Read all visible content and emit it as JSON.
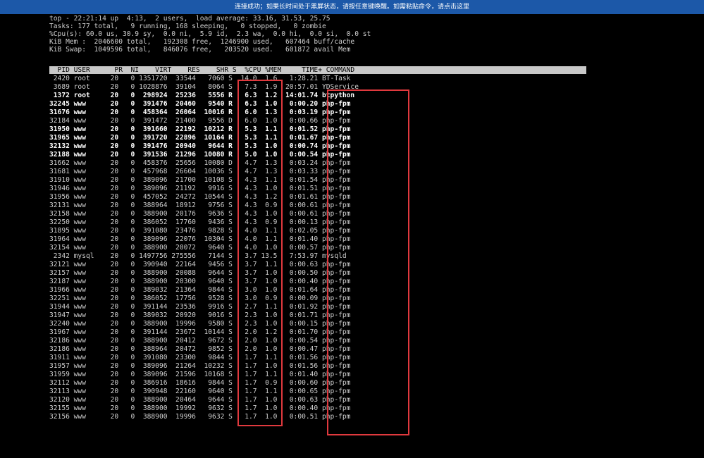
{
  "banner": {
    "text": "连接成功；如果长时间处于黑屏状态，请按任意键唤醒。如需粘贴命令，请点击这里"
  },
  "summary": [
    "top - 22:21:14 up  4:13,  2 users,  load average: 33.16, 31.53, 25.75",
    "Tasks: 177 total,   9 running, 168 sleeping,   0 stopped,   0 zombie",
    "%Cpu(s): 60.0 us, 30.9 sy,  0.0 ni,  5.9 id,  2.3 wa,  0.0 hi,  0.0 si,  0.0 st",
    "KiB Mem :  2046600 total,   192308 free,  1246900 used,   607464 buff/cache",
    "KiB Swap:  1049596 total,   846076 free,   203520 used.   601872 avail Mem"
  ],
  "header": "  PID USER      PR  NI    VIRT    RES    SHR S  %CPU %MEM     TIME+ COMMAND",
  "processes": [
    [
      "2420",
      "root",
      "20",
      "0",
      "1351720",
      "33544",
      "7060",
      "S",
      "14.0",
      "1.6",
      "1:28.21",
      "BT-Task",
      false
    ],
    [
      "3689",
      "root",
      "20",
      "0",
      "1028876",
      "39104",
      "8064",
      "S",
      "7.3",
      "1.9",
      "20:57.01",
      "YDService",
      false
    ],
    [
      "1372",
      "root",
      "20",
      "0",
      "298924",
      "25236",
      "5556",
      "R",
      "6.3",
      "1.2",
      "14:01.74",
      "btpython",
      true
    ],
    [
      "32245",
      "www",
      "20",
      "0",
      "391476",
      "20460",
      "9540",
      "R",
      "6.3",
      "1.0",
      "0:00.20",
      "php-fpm",
      true
    ],
    [
      "31676",
      "www",
      "20",
      "0",
      "458364",
      "26064",
      "10016",
      "R",
      "6.0",
      "1.3",
      "0:03.19",
      "php-fpm",
      true
    ],
    [
      "32184",
      "www",
      "20",
      "0",
      "391472",
      "21400",
      "9556",
      "D",
      "6.0",
      "1.0",
      "0:00.66",
      "php-fpm",
      false
    ],
    [
      "31950",
      "www",
      "20",
      "0",
      "391660",
      "22192",
      "10212",
      "R",
      "5.3",
      "1.1",
      "0:01.52",
      "php-fpm",
      true
    ],
    [
      "31965",
      "www",
      "20",
      "0",
      "391720",
      "22896",
      "10164",
      "R",
      "5.3",
      "1.1",
      "0:01.67",
      "php-fpm",
      true
    ],
    [
      "32132",
      "www",
      "20",
      "0",
      "391476",
      "20940",
      "9644",
      "R",
      "5.3",
      "1.0",
      "0:00.74",
      "php-fpm",
      true
    ],
    [
      "32188",
      "www",
      "20",
      "0",
      "391536",
      "21296",
      "10080",
      "R",
      "5.0",
      "1.0",
      "0:00.54",
      "php-fpm",
      true
    ],
    [
      "31662",
      "www",
      "20",
      "0",
      "458376",
      "25656",
      "10080",
      "D",
      "4.7",
      "1.3",
      "0:03.24",
      "php-fpm",
      false
    ],
    [
      "31681",
      "www",
      "20",
      "0",
      "457968",
      "26604",
      "10036",
      "S",
      "4.7",
      "1.3",
      "0:03.33",
      "php-fpm",
      false
    ],
    [
      "31910",
      "www",
      "20",
      "0",
      "389096",
      "21700",
      "10108",
      "S",
      "4.3",
      "1.1",
      "0:01.54",
      "php-fpm",
      false
    ],
    [
      "31946",
      "www",
      "20",
      "0",
      "389096",
      "21192",
      "9916",
      "S",
      "4.3",
      "1.0",
      "0:01.51",
      "php-fpm",
      false
    ],
    [
      "31956",
      "www",
      "20",
      "0",
      "457052",
      "24272",
      "10544",
      "S",
      "4.3",
      "1.2",
      "0:01.61",
      "php-fpm",
      false
    ],
    [
      "32131",
      "www",
      "20",
      "0",
      "388964",
      "18912",
      "9756",
      "S",
      "4.3",
      "0.9",
      "0:00.61",
      "php-fpm",
      false
    ],
    [
      "32158",
      "www",
      "20",
      "0",
      "388900",
      "20176",
      "9636",
      "S",
      "4.3",
      "1.0",
      "0:00.61",
      "php-fpm",
      false
    ],
    [
      "32250",
      "www",
      "20",
      "0",
      "386052",
      "17760",
      "9436",
      "S",
      "4.3",
      "0.9",
      "0:00.13",
      "php-fpm",
      false
    ],
    [
      "31895",
      "www",
      "20",
      "0",
      "391080",
      "23476",
      "9828",
      "S",
      "4.0",
      "1.1",
      "0:02.05",
      "php-fpm",
      false
    ],
    [
      "31964",
      "www",
      "20",
      "0",
      "389096",
      "22076",
      "10304",
      "S",
      "4.0",
      "1.1",
      "0:01.40",
      "php-fpm",
      false
    ],
    [
      "32154",
      "www",
      "20",
      "0",
      "388900",
      "20072",
      "9640",
      "S",
      "4.0",
      "1.0",
      "0:00.57",
      "php-fpm",
      false
    ],
    [
      "2342",
      "mysql",
      "20",
      "0",
      "1497756",
      "275556",
      "7144",
      "S",
      "3.7",
      "13.5",
      "7:53.97",
      "mysqld",
      false
    ],
    [
      "32121",
      "www",
      "20",
      "0",
      "390940",
      "22164",
      "9456",
      "S",
      "3.7",
      "1.1",
      "0:00.63",
      "php-fpm",
      false
    ],
    [
      "32157",
      "www",
      "20",
      "0",
      "388900",
      "20088",
      "9644",
      "S",
      "3.7",
      "1.0",
      "0:00.50",
      "php-fpm",
      false
    ],
    [
      "32187",
      "www",
      "20",
      "0",
      "388900",
      "20300",
      "9640",
      "S",
      "3.7",
      "1.0",
      "0:00.40",
      "php-fpm",
      false
    ],
    [
      "31966",
      "www",
      "20",
      "0",
      "389032",
      "21364",
      "9844",
      "S",
      "3.0",
      "1.0",
      "0:01.64",
      "php-fpm",
      false
    ],
    [
      "32251",
      "www",
      "20",
      "0",
      "386052",
      "17756",
      "9528",
      "S",
      "3.0",
      "0.9",
      "0:00.09",
      "php-fpm",
      false
    ],
    [
      "31944",
      "www",
      "20",
      "0",
      "391144",
      "23536",
      "9916",
      "S",
      "2.7",
      "1.1",
      "0:01.92",
      "php-fpm",
      false
    ],
    [
      "31947",
      "www",
      "20",
      "0",
      "389032",
      "20920",
      "9016",
      "S",
      "2.3",
      "1.0",
      "0:01.71",
      "php-fpm",
      false
    ],
    [
      "32240",
      "www",
      "20",
      "0",
      "388900",
      "19996",
      "9580",
      "S",
      "2.3",
      "1.0",
      "0:00.15",
      "php-fpm",
      false
    ],
    [
      "31967",
      "www",
      "20",
      "0",
      "391144",
      "23672",
      "10144",
      "S",
      "2.0",
      "1.2",
      "0:01.70",
      "php-fpm",
      false
    ],
    [
      "32186",
      "www",
      "20",
      "0",
      "388900",
      "20412",
      "9672",
      "S",
      "2.0",
      "1.0",
      "0:00.54",
      "php-fpm",
      false
    ],
    [
      "32186",
      "www",
      "20",
      "0",
      "388964",
      "20472",
      "9852",
      "S",
      "2.0",
      "1.0",
      "0:00.47",
      "php-fpm",
      false
    ],
    [
      "31911",
      "www",
      "20",
      "0",
      "391080",
      "23300",
      "9844",
      "S",
      "1.7",
      "1.1",
      "0:01.56",
      "php-fpm",
      false
    ],
    [
      "31957",
      "www",
      "20",
      "0",
      "389096",
      "21264",
      "10232",
      "S",
      "1.7",
      "1.0",
      "0:01.56",
      "php-fpm",
      false
    ],
    [
      "31959",
      "www",
      "20",
      "0",
      "389096",
      "21596",
      "10168",
      "S",
      "1.7",
      "1.1",
      "0:01.40",
      "php-fpm",
      false
    ],
    [
      "32112",
      "www",
      "20",
      "0",
      "386916",
      "18616",
      "9844",
      "S",
      "1.7",
      "0.9",
      "0:00.60",
      "php-fpm",
      false
    ],
    [
      "32113",
      "www",
      "20",
      "0",
      "390948",
      "22160",
      "9640",
      "S",
      "1.7",
      "1.1",
      "0:00.65",
      "php-fpm",
      false
    ],
    [
      "32120",
      "www",
      "20",
      "0",
      "388900",
      "20464",
      "9644",
      "S",
      "1.7",
      "1.0",
      "0:00.63",
      "php-fpm",
      false
    ],
    [
      "32155",
      "www",
      "20",
      "0",
      "388900",
      "19992",
      "9632",
      "S",
      "1.7",
      "1.0",
      "0:00.40",
      "php-fpm",
      false
    ],
    [
      "32156",
      "www",
      "20",
      "0",
      "388900",
      "19996",
      "9632",
      "S",
      "1.7",
      "1.0",
      "0:00.51",
      "php-fpm",
      false
    ]
  ],
  "highlight_color": "#e0393e"
}
